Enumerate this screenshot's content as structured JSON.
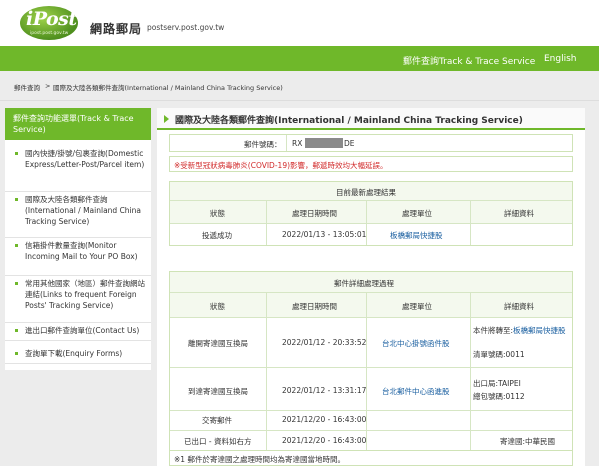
{
  "header": {
    "logo_text": "iPost",
    "logo_sub": "ipost.post.gov.tw",
    "site_name": "網路郵局",
    "site_url": "postserv.post.gov.tw",
    "nav_track": "郵件查詢Track & Trace Service",
    "nav_english": "English"
  },
  "breadcrumb": {
    "home": "郵件查詢",
    "sep": ">",
    "current": "國際及大陸各類郵件查詢(International / Mainland China Tracking Service)"
  },
  "sidebar": {
    "title": "郵件查詢功能選單(Track & Trace Service)",
    "items": [
      {
        "label": "國內快捷/掛號/包裹查詢(Domestic Express/Letter-Post/Parcel item)"
      },
      {
        "label": "國際及大陸各類郵件查詢(International / Mainland China Tracking Service)"
      },
      {
        "label": "信箱掛件數量查詢(Monitor Incoming Mail to Your PO Box)"
      },
      {
        "label": "常用其他國家（地區）郵件查詢網站連結(Links to frequent Foreign Posts' Tracking Service)"
      },
      {
        "label": "進出口郵件查詢單位(Contact Us)"
      },
      {
        "label": "查詢單下載(Enquiry Forms)"
      }
    ]
  },
  "main": {
    "title": "國際及大陸各類郵件查詢(International / Mainland China Tracking Service)",
    "tracking_label": "郵件號碼：",
    "tracking_prefix": "RX",
    "tracking_suffix": "DE",
    "notice": "※受新型冠狀病毒肺炎(COVID-19)影響，郵遞時效均大幅延誤。",
    "latest": {
      "section_title": "目前最新處理結果",
      "headers": [
        "狀態",
        "處理日期時間",
        "處理單位",
        "詳細資料"
      ],
      "row": {
        "status": "投遞成功",
        "datetime": "2022/01/13 - 13:05:01",
        "unit": "板橋郵局快捷股",
        "detail": ""
      }
    },
    "history": {
      "section_title": "郵件詳細處理過程",
      "headers": [
        "狀態",
        "處理日期時間",
        "處理單位",
        "詳細資料"
      ],
      "rows": [
        {
          "status": "離開寄達國互換局",
          "datetime": "2022/01/12 - 20:33:52",
          "unit": "台北中心掛號函件股",
          "detail1": "本件將轉至:板橋郵局快捷股",
          "detail2": "清單號碼:0011"
        },
        {
          "status": "到達寄達國互換局",
          "datetime": "2022/01/12 - 13:31:17",
          "unit": "台北郵件中心函進股",
          "detail1": "出口局:TAIPEI",
          "detail2": "總包號碼:0112"
        },
        {
          "status": "交寄郵件",
          "datetime": "2021/12/20 - 16:43:00",
          "unit": "",
          "detail1": "",
          "detail2": ""
        },
        {
          "status": "已出口 - 資料如右方",
          "datetime": "2021/12/20 - 16:43:00",
          "unit": "",
          "detail1": "寄達國:中華民國",
          "detail2": ""
        }
      ]
    },
    "footnote": "※1 郵件於寄達國之處理時間均為寄達國當地時間。"
  },
  "colors": {
    "brand_green": "#6fb82a",
    "link_blue": "#1a5fa0",
    "notice_red": "#d12a2a"
  }
}
